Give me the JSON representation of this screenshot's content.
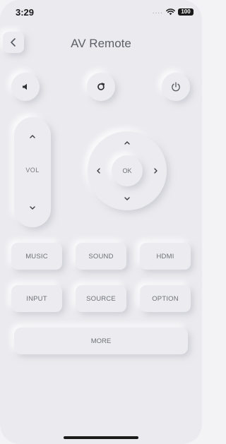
{
  "status_bar": {
    "time": "3:29",
    "signal": "....",
    "battery": "100"
  },
  "header": {
    "title": "AV Remote",
    "back_icon": "chevron-left-icon"
  },
  "top_controls": [
    {
      "name": "mute",
      "icon": "speaker-icon"
    },
    {
      "name": "refresh",
      "icon": "refresh-icon"
    },
    {
      "name": "power",
      "icon": "power-icon"
    }
  ],
  "volume": {
    "label": "VOL",
    "up_icon": "chevron-up-icon",
    "down_icon": "chevron-down-icon"
  },
  "dpad": {
    "ok_label": "OK"
  },
  "buttons": {
    "music": "MUSIC",
    "sound": "SOUND",
    "hdmi": "HDMI",
    "input": "INPUT",
    "source": "SOURCE",
    "option": "OPTION",
    "more": "MORE"
  },
  "colors": {
    "background": "#ebebef",
    "text": "#6d7078",
    "title": "#5d6068"
  }
}
